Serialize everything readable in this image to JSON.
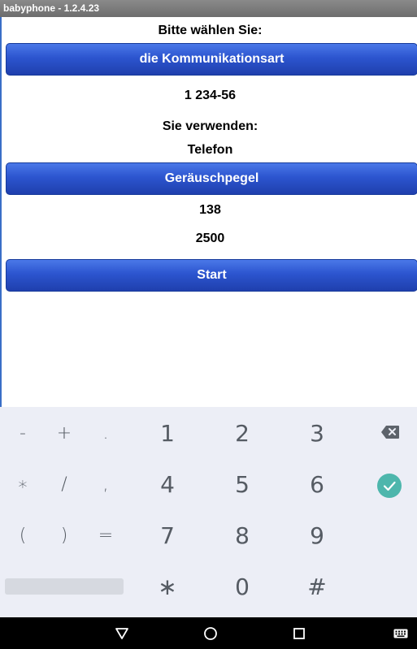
{
  "titlebar": {
    "title": "babyphone - 1.2.4.23"
  },
  "app": {
    "prompt": "Bitte wählen Sie:",
    "comm_button": "die Kommunikationsart",
    "number": "1 234-56",
    "using_label": "Sie verwenden:",
    "using_value": "Telefon",
    "noise_button": "Geräuschpegel",
    "noise_value": "138",
    "second_value": "2500",
    "start_button": "Start"
  },
  "keyboard": {
    "row1": [
      "-",
      "+",
      ".",
      "1",
      "2",
      "3"
    ],
    "row2": [
      "∗",
      "/",
      ",",
      "4",
      "5",
      "6"
    ],
    "row3": [
      "(",
      ")",
      "=",
      "7",
      "8",
      "9"
    ],
    "row4": [
      "∗",
      "0",
      "#"
    ],
    "icons": {
      "backspace": "backspace-icon",
      "enter": "done-check-icon"
    },
    "accent_color": "#4db6ac"
  },
  "navbar": {
    "icons": [
      "back-triangle-icon",
      "home-circle-icon",
      "recents-square-icon",
      "keyboard-icon"
    ]
  }
}
